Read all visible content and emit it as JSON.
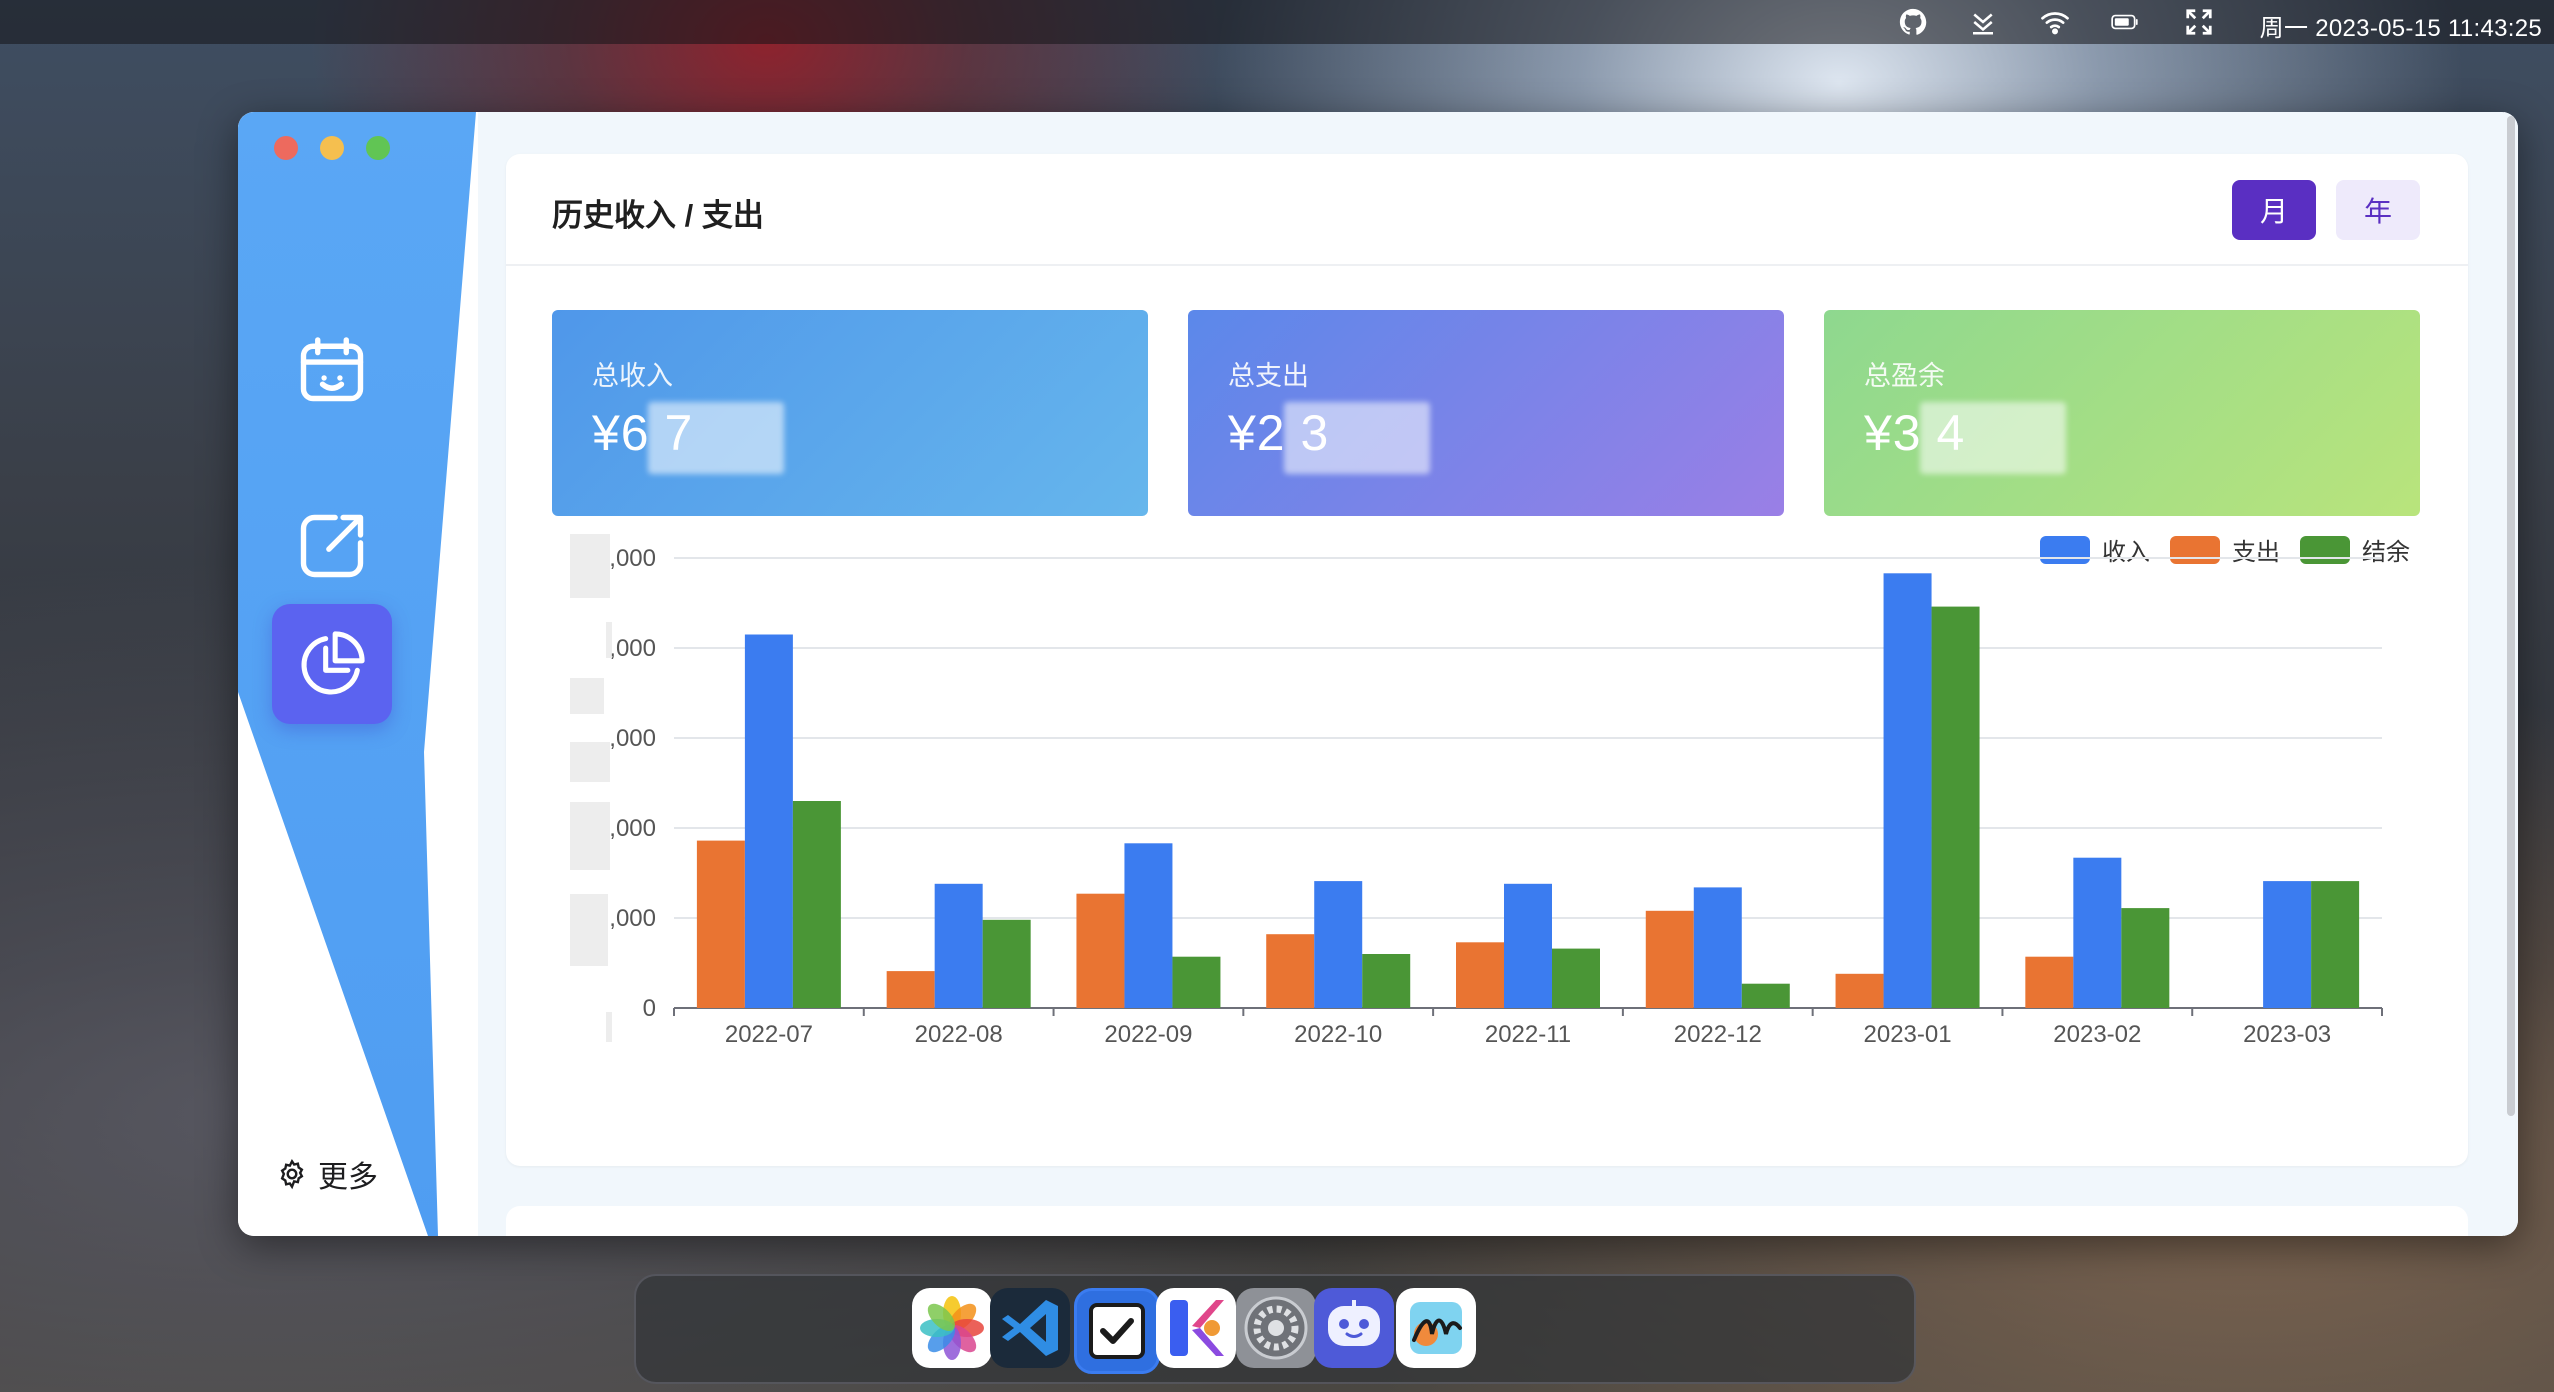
{
  "menubar": {
    "icons": [
      "github-icon",
      "download-icon",
      "wifi-icon",
      "battery-icon",
      "fullscreen-icon"
    ],
    "clock": "周一  2023-05-15 11:43:25"
  },
  "window": {
    "traffic_lights": {
      "close": "#ed6a5e",
      "minimize": "#f5bf4f",
      "zoom": "#61c554"
    },
    "sidebar": {
      "accent": "#5aa7f5",
      "items": [
        {
          "icon": "calendar-icon",
          "active": false
        },
        {
          "icon": "share-icon",
          "active": false
        },
        {
          "icon": "pie-chart-icon",
          "active": true
        }
      ],
      "more_label": "更多"
    },
    "card": {
      "title": "历史收入 / 支出",
      "toggles": {
        "month": "月",
        "year": "年"
      },
      "stats": [
        {
          "label": "总收入",
          "value": "¥6      7"
        },
        {
          "label": "总支出",
          "value": "¥2      3"
        },
        {
          "label": "总盈余",
          "value": "¥3      4"
        }
      ]
    }
  },
  "chart_data": {
    "type": "bar",
    "categories": [
      "2022-07",
      "2022-08",
      "2022-09",
      "2022-10",
      "2022-11",
      "2022-12",
      "2023-01",
      "2023-02",
      "2023-03"
    ],
    "series": [
      {
        "name": "收入",
        "color": "#3b7cf0",
        "values": [
          4150,
          1380,
          1830,
          1410,
          1380,
          1340,
          4830,
          1670,
          1410
        ]
      },
      {
        "name": "支出",
        "color": "#e97432",
        "values": [
          1860,
          410,
          1270,
          820,
          730,
          1080,
          380,
          570,
          0
        ]
      },
      {
        "name": "结余",
        "color": "#4a9636",
        "values": [
          2300,
          980,
          570,
          600,
          660,
          270,
          4460,
          1110,
          1410
        ]
      }
    ],
    "y_tick_labels": [
      ",000",
      ",000",
      ",000",
      ",000",
      ",000",
      "0"
    ],
    "ylim": [
      0,
      5000
    ],
    "legend_position": "top-right",
    "grid": true
  },
  "dock": {
    "apps": [
      "photos-icon",
      "vscode-icon",
      "todo-checkbox-icon",
      "kuaidou-icon",
      "system-settings-icon",
      "robot-assistant-icon",
      "freeform-icon"
    ]
  }
}
